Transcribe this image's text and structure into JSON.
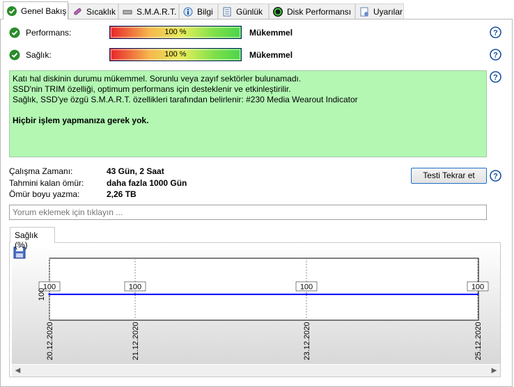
{
  "tabs": [
    {
      "label": "Genel Bakış",
      "icon": "check-circle-icon",
      "active": true
    },
    {
      "label": "Sıcaklık",
      "icon": "thermometer-icon"
    },
    {
      "label": "S.M.A.R.T.",
      "icon": "drive-icon"
    },
    {
      "label": "Bilgi",
      "icon": "info-icon"
    },
    {
      "label": "Günlük",
      "icon": "log-icon"
    },
    {
      "label": "Disk Performansı",
      "icon": "gauge-icon"
    },
    {
      "label": "Uyarılar",
      "icon": "alert-doc-icon"
    }
  ],
  "performance": {
    "label": "Performans:",
    "value_text": "100 %",
    "value": 100,
    "status": "Mükemmel"
  },
  "health": {
    "label": "Sağlık:",
    "value_text": "100 %",
    "value": 100,
    "status": "Mükemmel"
  },
  "message": {
    "line1": "Katı hal diskinin durumu mükemmel. Sorunlu veya zayıf sektörler bulunamadı.",
    "line2": "SSD'nin TRIM özelliği, optimum performans için desteklenir ve etkinleştirilir.",
    "line3": "Sağlık, SSD'ye özgü S.M.A.R.T. özellikleri tarafından belirlenir: #230 Media Wearout Indicator",
    "action": "Hiçbir işlem yapmanıza gerek yok."
  },
  "info": {
    "uptime_label": "Çalışma Zamanı:",
    "uptime_value": "43 Gün, 2 Saat",
    "remaining_label": "Tahmini kalan ömür:",
    "remaining_value": "daha fazla 1000 Gün",
    "written_label": "Ömür boyu yazma:",
    "written_value": "2,26 TB"
  },
  "retest_button": "Testi Tekrar et",
  "comment_placeholder": "Yorum eklemek için tıklayın ...",
  "chart_tab": "Sağlık (%)",
  "colors": {
    "accent": "#1e6fc8",
    "message_bg": "#b3f7b3",
    "series_line": "#0000ff",
    "check_green": "#2a9d2a"
  },
  "chart_data": {
    "type": "line",
    "x": [
      "20.12.2020",
      "21.12.2020",
      "23.12.2020",
      "25.12.2020"
    ],
    "series": [
      {
        "values": [
          100,
          100,
          100,
          100
        ]
      }
    ],
    "y_tick_labels": [
      "100"
    ],
    "data_labels": [
      "100",
      "100",
      "100",
      "100"
    ],
    "grid": true
  }
}
